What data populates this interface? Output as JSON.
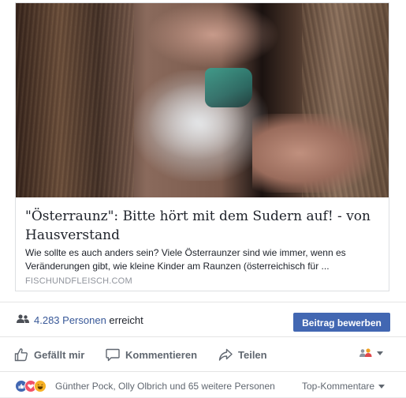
{
  "link_preview": {
    "title": "\"Österraunz\": Bitte hört mit dem Sudern auf! - von Hausverstand",
    "description": "Wie sollte es auch anders sein? Viele Österraunzer sind wie immer, wenn es Veränderungen gibt, wie kleine Kinder am Raunzen (österreichisch für ...",
    "domain": "FISCHUNDFLEISCH.COM"
  },
  "reach": {
    "count_link": "4.283 Personen",
    "suffix": "erreicht",
    "icon": "people-icon"
  },
  "promote_button": {
    "label": "Beitrag bewerben"
  },
  "actions": {
    "like": {
      "label": "Gefällt mir",
      "icon": "thumbs-up-icon"
    },
    "comment": {
      "label": "Kommentieren",
      "icon": "speech-bubble-icon"
    },
    "share": {
      "label": "Teilen",
      "icon": "share-arrow-icon"
    },
    "audience": {
      "icon": "friends-audience-icon"
    }
  },
  "reactions": {
    "icons": [
      "like-reaction-icon",
      "love-reaction-icon",
      "haha-reaction-icon"
    ],
    "text": "Günther Pock, Olly Olbrich und 65 weitere Personen",
    "sort_label": "Top-Kommentare"
  },
  "colors": {
    "brand_blue": "#4267b2",
    "link_blue": "#385898",
    "muted_text": "#606770"
  }
}
